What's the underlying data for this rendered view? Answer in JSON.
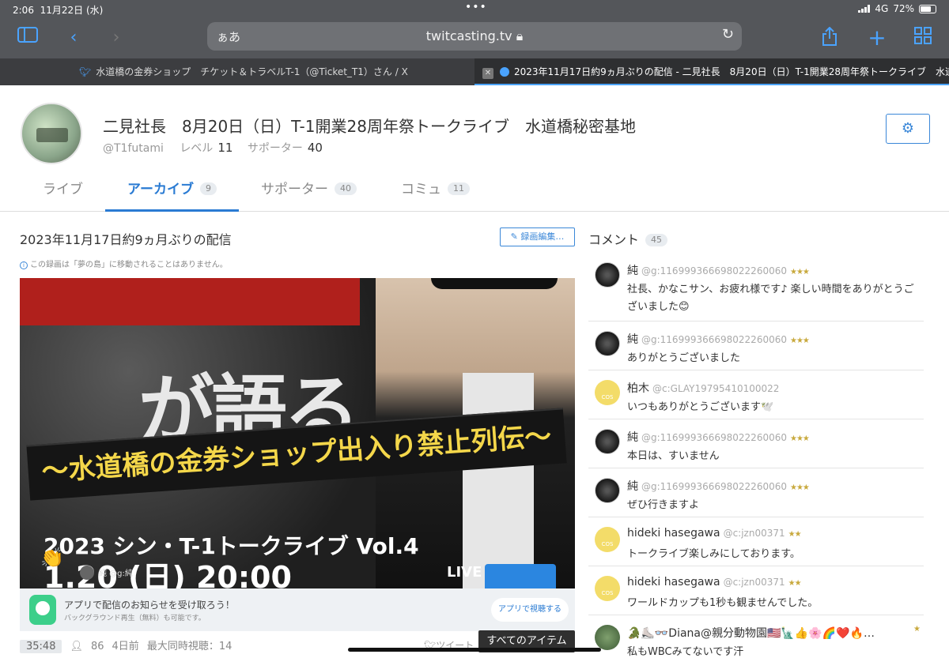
{
  "status": {
    "time": "2:06",
    "date": "11月22日 (水)",
    "network": "4G",
    "battery": "72%",
    "battery_level": 0.72
  },
  "browser": {
    "aa_label": "ぁあ",
    "domain": "twitcasting.tv",
    "tabs": [
      {
        "title": "水道橋の金券ショップ　チケット＆トラベルT-1（@Ticket_T1）さん / X"
      },
      {
        "title": "2023年11月17日約9ヵ月ぶりの配信 - 二見社長　8月20日（日）T-1開業28周年祭トークライブ　水道橋秘密基地"
      }
    ],
    "close_tab": "✕"
  },
  "channel": {
    "title": "二見社長　8月20日（日）T-1開業28周年祭トークライブ　水道橋秘密基地",
    "handle": "@T1futami",
    "level_label": "レベル",
    "level": "11",
    "supporter_label": "サポーター",
    "supporters": "40"
  },
  "navtabs": [
    {
      "label": "ライブ",
      "count": ""
    },
    {
      "label": "アーカイブ",
      "count": "9"
    },
    {
      "label": "サポーター",
      "count": "40"
    },
    {
      "label": "コミュ",
      "count": "11"
    }
  ],
  "video": {
    "title": "2023年11月17日約9ヵ月ぶりの配信",
    "edit_label": "録画編集…",
    "notice": "この録画は「夢の島」に移動されることはありません。",
    "thumb_text": {
      "top": "が語る",
      "ribbon": "〜水道橋の金券ショップ出入り禁止列伝〜",
      "series": "2023 シン・T-1トークライブ Vol.4",
      "date": "1.20 (日) 20:00",
      "live_start": "LIVE START",
      "viewer": "純 @g:純"
    },
    "app_promo": {
      "line1": "アプリで配信のお知らせを受け取ろう！",
      "line2": "バックグラウンド再生（無料）も可能です。",
      "button": "アプリで視聴する"
    },
    "duration": "35:48",
    "views": "86",
    "ago": "4日前",
    "max_viewers": "最大同時視聴：14",
    "tweet": "ツイート",
    "all_items": "すべてのアイテム"
  },
  "comments_header": {
    "label": "コメント",
    "count": "45"
  },
  "comments": [
    {
      "name": "純",
      "uid": "@g:116999366698022260060",
      "stars": "★★★",
      "text": "社長、かなこサン、お疲れ様です♪ 楽しい時間をありがとうございました😊",
      "avatar": "dark"
    },
    {
      "name": "純",
      "uid": "@g:116999366698022260060",
      "stars": "★★★",
      "text": "ありがとうございました",
      "avatar": "dark"
    },
    {
      "name": "柏木",
      "uid": "@c:GLAY19795410100022",
      "stars": "",
      "text": "いつもありがとうございます🕊️",
      "avatar": "cos"
    },
    {
      "name": "純",
      "uid": "@g:116999366698022260060",
      "stars": "★★★",
      "text": "本日は、すいません",
      "avatar": "dark"
    },
    {
      "name": "純",
      "uid": "@g:116999366698022260060",
      "stars": "★★★",
      "text": "ぜひ行きますよ",
      "avatar": "dark"
    },
    {
      "name": "hideki hasegawa",
      "uid": "@c:jzn00371",
      "stars": "★★",
      "text": "トークライブ楽しみにしております。",
      "avatar": "cos"
    },
    {
      "name": "hideki hasegawa",
      "uid": "@c:jzn00371",
      "stars": "★★",
      "text": "ワールドカップも1秒も観ませんでした。",
      "avatar": "cos"
    },
    {
      "name": "🐊⛸️👓Diana@親分動物園🇺🇸🗽👍🌸🌈❤️🔥…",
      "uid": "",
      "stars": "★",
      "text": "私もWBCみてないです汗",
      "avatar": "diana"
    }
  ]
}
